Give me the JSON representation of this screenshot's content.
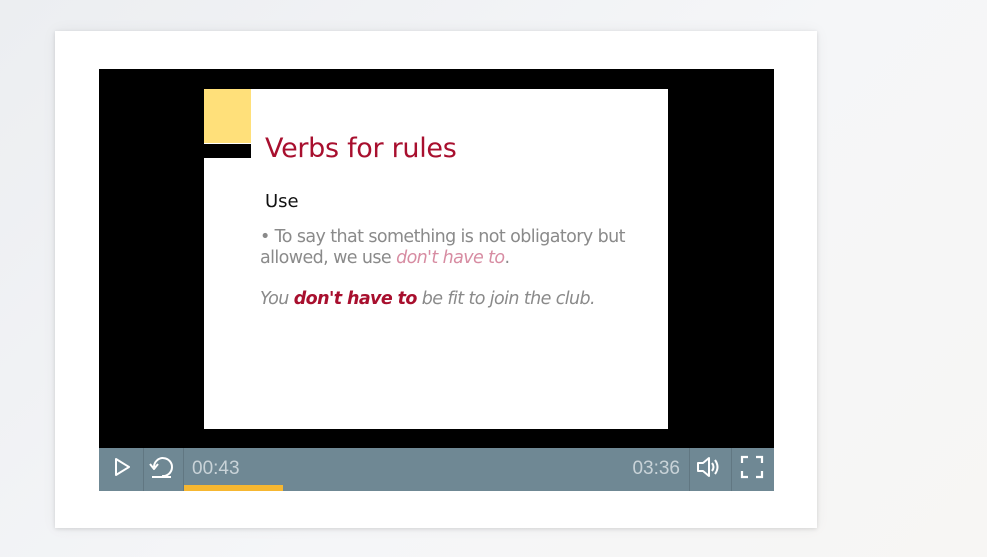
{
  "slide": {
    "title": "Verbs for rules",
    "subtitle": "Use",
    "bullet_prefix": "• To say that something is not obligatory but allowed, we use ",
    "bullet_emphasis": "don't have to",
    "bullet_suffix": ".",
    "example_prefix": "You ",
    "example_emphasis": "don't have to",
    "example_suffix": " be fit to join the club."
  },
  "controls": {
    "current_time": "00:43",
    "total_time": "03:36",
    "progress_fraction": 0.197,
    "play_icon": "play-icon",
    "replay_icon": "replay-icon",
    "volume_icon": "volume-icon",
    "fullscreen_icon": "fullscreen-icon"
  },
  "colors": {
    "controls_bg": "#6f8894",
    "progress": "#f6b731",
    "title_red": "#a80f2e",
    "accent_yellow": "#ffe07a"
  }
}
